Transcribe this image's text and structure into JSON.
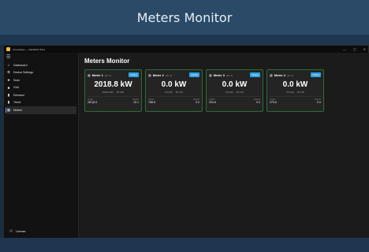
{
  "banner": {
    "title": "Meters Monitor"
  },
  "window": {
    "title": "PowerEdge — GENERIC #511",
    "controls": [
      "—",
      "▢",
      "✕"
    ]
  },
  "sidebar": {
    "items": [
      {
        "icon": "home-icon",
        "glyph": "⌂",
        "label": "Dashboard"
      },
      {
        "icon": "gear-icon",
        "glyph": "⚙",
        "label": "Device Settings"
      },
      {
        "icon": "star-icon",
        "glyph": "★",
        "label": "Scan"
      },
      {
        "icon": "square-icon",
        "glyph": "■",
        "label": "Grid"
      },
      {
        "icon": "bar-chart-icon",
        "glyph": "▮",
        "label": "Demand"
      },
      {
        "icon": "trend-chart-icon",
        "glyph": "▮",
        "label": "Trend"
      },
      {
        "icon": "grid-icon",
        "glyph": "▦",
        "label": "Meters",
        "active": true
      }
    ],
    "license": {
      "icon": "user-icon",
      "glyph": "⚇",
      "label": "License"
    }
  },
  "page": {
    "title": "Meters Monitor"
  },
  "meters": [
    {
      "name": "Meter 1",
      "id": "(ID: 1)",
      "status": "Online",
      "power": "2018.8 kW",
      "sub_left": "2004.0 kVar",
      "sub_right": "PF 0.99",
      "left_label": "Import",
      "left_value": "287(8.5",
      "right_label": "Export",
      "right_value": "19.1"
    },
    {
      "name": "Meter 2",
      "id": "(ID: 2)",
      "status": "Online",
      "power": "0.0 kW",
      "sub_left": "0.0 kVar",
      "sub_right": "PF 0.00",
      "left_label": "Import",
      "left_value": "788.6",
      "right_label": "Export",
      "right_value": "0.0"
    },
    {
      "name": "Meter 3",
      "id": "(ID: 3)",
      "status": "Online",
      "power": "0.0 kW",
      "sub_left": "0.0 kVar",
      "sub_right": "PF 0.00",
      "left_label": "Import",
      "left_value": "203.6",
      "right_label": "Export",
      "right_value": "0.0"
    },
    {
      "name": "Meter 4",
      "id": "(ID: 4)",
      "status": "Online",
      "power": "0.0 kW",
      "sub_left": "0.0 kVar",
      "sub_right": "PF 0.00",
      "left_label": "Import",
      "left_value": "379.6",
      "right_label": "Export",
      "right_value": "0.0"
    }
  ]
}
